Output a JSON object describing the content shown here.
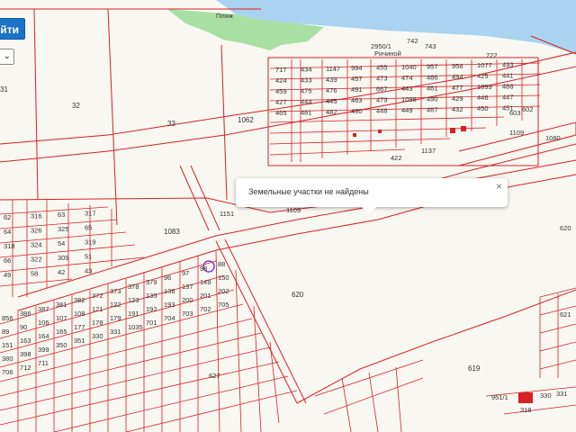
{
  "toolbar": {
    "find_label": "йти"
  },
  "popup": {
    "message": "Земельные участки не найдены",
    "close_glyph": "×"
  },
  "select": {
    "chevron": "⌄"
  },
  "map": {
    "features": [
      "Пляж",
      "Ричиной",
      "2950/1",
      "742",
      "743",
      "722"
    ],
    "parcels": [
      "31",
      "32",
      "33",
      "1062",
      "1083",
      "620",
      "619",
      "627",
      "1151",
      "1109",
      "1137",
      "1109",
      "1080",
      "422",
      "603",
      "602",
      "620",
      "621",
      "318",
      "330",
      "331",
      "951/1"
    ],
    "grid_left": [
      "62",
      "316",
      "63",
      "317",
      "64",
      "326",
      "325",
      "65",
      "318",
      "324",
      "54",
      "319",
      "66",
      "322",
      "309",
      "51",
      "49",
      "58",
      "42",
      "43"
    ],
    "grid_top": [
      "717",
      "434",
      "1147",
      "994",
      "455",
      "1040",
      "957",
      "958",
      "1077",
      "493",
      "424",
      "433",
      "439",
      "457",
      "473",
      "474",
      "486",
      "494",
      "425",
      "441",
      "459",
      "475",
      "476",
      "491",
      "667",
      "443",
      "461",
      "477",
      "1099",
      "488",
      "427",
      "444",
      "445",
      "463",
      "479",
      "1098",
      "490",
      "429",
      "446",
      "447",
      "465",
      "481",
      "482",
      "430",
      "448",
      "449",
      "467",
      "432",
      "450",
      "451"
    ],
    "grid_bottom": [
      "856",
      "386",
      "387",
      "381",
      "382",
      "372",
      "373",
      "378",
      "379",
      "96",
      "97",
      "98",
      "88",
      "89",
      "90",
      "106",
      "107",
      "108",
      "121",
      "122",
      "123",
      "135",
      "136",
      "137",
      "149",
      "150",
      "151",
      "163",
      "164",
      "165",
      "177",
      "178",
      "179",
      "191",
      "192",
      "193",
      "200",
      "201",
      "202",
      "380",
      "398",
      "399",
      "350",
      "351",
      "330",
      "331",
      "1035",
      "701",
      "704",
      "703",
      "702",
      "705",
      "706",
      "712",
      "711"
    ]
  }
}
